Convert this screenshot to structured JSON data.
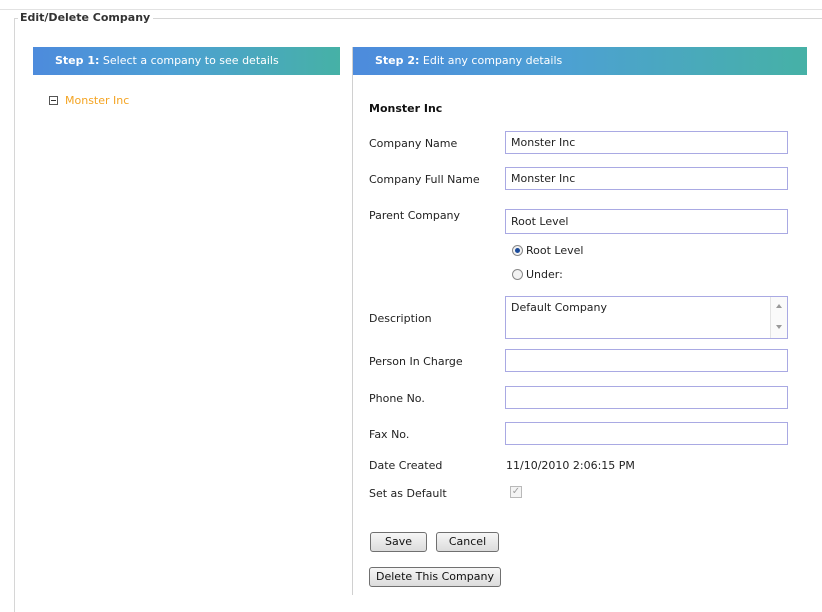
{
  "fieldset": {
    "legend": "Edit/Delete Company"
  },
  "step1": {
    "prefix": "Step 1:",
    "text": " Select a company to see details"
  },
  "step2": {
    "prefix": "Step 2:",
    "text": " Edit any company details"
  },
  "tree": {
    "items": [
      {
        "label": "Monster Inc",
        "expanded": true
      }
    ]
  },
  "details": {
    "title": "Monster Inc",
    "company_name_label": "Company Name",
    "company_name_value": "Monster Inc",
    "company_full_name_label": "Company Full Name",
    "company_full_name_value": "Monster Inc",
    "parent_company_label": "Parent Company",
    "parent_company_value": "Root Level",
    "radio_root_label": "Root Level",
    "radio_under_label": "Under:",
    "radio_selected": "Root Level",
    "description_label": "Description",
    "description_value": "Default Company",
    "person_in_charge_label": "Person In Charge",
    "person_in_charge_value": "",
    "phone_label": "Phone No.",
    "phone_value": "",
    "fax_label": "Fax No.",
    "fax_value": "",
    "date_created_label": "Date Created",
    "date_created_value": "11/10/2010 2:06:15 PM",
    "set_default_label": "Set as Default",
    "set_default_checked": true
  },
  "buttons": {
    "save": "Save",
    "cancel": "Cancel",
    "delete": "Delete This Company"
  },
  "colors": {
    "tree_link": "#f4a422",
    "header_start": "#4d8bdc",
    "header_end": "#46b1a6"
  }
}
